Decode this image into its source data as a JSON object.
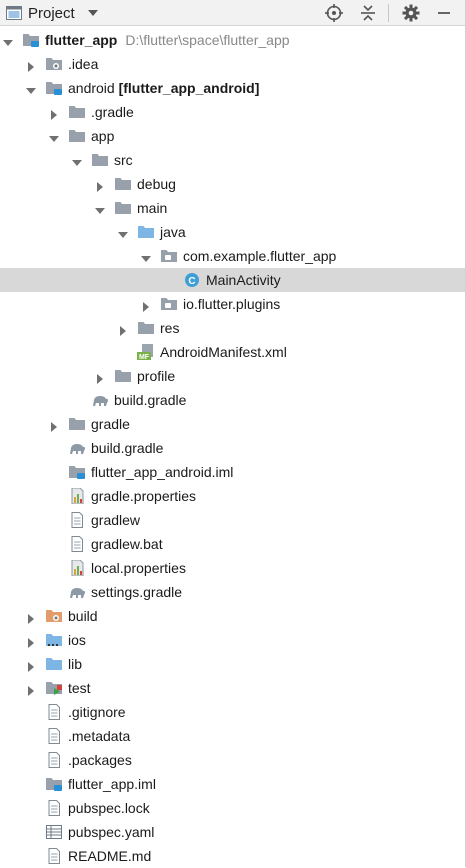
{
  "toolbar": {
    "title": "Project",
    "icons": [
      "project-icon",
      "chevron-down-icon",
      "locate-icon",
      "collapse-all-icon",
      "gear-icon",
      "minimize-icon"
    ]
  },
  "colors": {
    "folder": "#98a1ab",
    "folder_blue": "#7db5e4",
    "selected": "#d8d8d8",
    "class_icon": "#3e9ed6",
    "gradle_elephant": "#8d9aa6"
  },
  "tree": [
    {
      "label": "flutter_app",
      "suffix": "D:\\flutter\\space\\flutter_app",
      "depth": 0,
      "arrow": "down",
      "icon": "module-folder",
      "bold": true
    },
    {
      "label": ".idea",
      "depth": 1,
      "arrow": "right",
      "icon": "idea-folder"
    },
    {
      "label": "android",
      "suffix_bold": "[flutter_app_android]",
      "depth": 1,
      "arrow": "down",
      "icon": "module-folder"
    },
    {
      "label": ".gradle",
      "depth": 2,
      "arrow": "right",
      "icon": "folder"
    },
    {
      "label": "app",
      "depth": 2,
      "arrow": "down",
      "icon": "folder"
    },
    {
      "label": "src",
      "depth": 3,
      "arrow": "down",
      "icon": "folder"
    },
    {
      "label": "debug",
      "depth": 4,
      "arrow": "right",
      "icon": "folder"
    },
    {
      "label": "main",
      "depth": 4,
      "arrow": "down",
      "icon": "folder"
    },
    {
      "label": "java",
      "depth": 5,
      "arrow": "down",
      "icon": "folder-blue"
    },
    {
      "label": "com.example.flutter_app",
      "depth": 6,
      "arrow": "down",
      "icon": "package"
    },
    {
      "label": "MainActivity",
      "depth": 7,
      "arrow": "",
      "icon": "class",
      "selected": true
    },
    {
      "label": "io.flutter.plugins",
      "depth": 6,
      "arrow": "right",
      "icon": "package"
    },
    {
      "label": "res",
      "depth": 5,
      "arrow": "right",
      "icon": "folder"
    },
    {
      "label": "AndroidManifest.xml",
      "depth": 5,
      "arrow": "",
      "icon": "manifest"
    },
    {
      "label": "profile",
      "depth": 4,
      "arrow": "right",
      "icon": "folder"
    },
    {
      "label": "build.gradle",
      "depth": 3,
      "arrow": "",
      "icon": "gradle"
    },
    {
      "label": "gradle",
      "depth": 2,
      "arrow": "right",
      "icon": "folder"
    },
    {
      "label": "build.gradle",
      "depth": 2,
      "arrow": "",
      "icon": "gradle"
    },
    {
      "label": "flutter_app_android.iml",
      "depth": 2,
      "arrow": "",
      "icon": "iml"
    },
    {
      "label": "gradle.properties",
      "depth": 2,
      "arrow": "",
      "icon": "properties"
    },
    {
      "label": "gradlew",
      "depth": 2,
      "arrow": "",
      "icon": "text-file"
    },
    {
      "label": "gradlew.bat",
      "depth": 2,
      "arrow": "",
      "icon": "text-file"
    },
    {
      "label": "local.properties",
      "depth": 2,
      "arrow": "",
      "icon": "properties"
    },
    {
      "label": "settings.gradle",
      "depth": 2,
      "arrow": "",
      "icon": "gradle"
    },
    {
      "label": "build",
      "depth": 1,
      "arrow": "right",
      "icon": "build-folder"
    },
    {
      "label": "ios",
      "depth": 1,
      "arrow": "right",
      "icon": "folder-dots"
    },
    {
      "label": "lib",
      "depth": 1,
      "arrow": "right",
      "icon": "folder-blue"
    },
    {
      "label": "test",
      "depth": 1,
      "arrow": "right",
      "icon": "test-folder"
    },
    {
      "label": ".gitignore",
      "depth": 1,
      "arrow": "",
      "icon": "text-file"
    },
    {
      "label": ".metadata",
      "depth": 1,
      "arrow": "",
      "icon": "text-file"
    },
    {
      "label": ".packages",
      "depth": 1,
      "arrow": "",
      "icon": "text-file"
    },
    {
      "label": "flutter_app.iml",
      "depth": 1,
      "arrow": "",
      "icon": "iml"
    },
    {
      "label": "pubspec.lock",
      "depth": 1,
      "arrow": "",
      "icon": "text-file"
    },
    {
      "label": "pubspec.yaml",
      "depth": 1,
      "arrow": "",
      "icon": "yaml"
    },
    {
      "label": "README.md",
      "depth": 1,
      "arrow": "",
      "icon": "text-file"
    }
  ]
}
